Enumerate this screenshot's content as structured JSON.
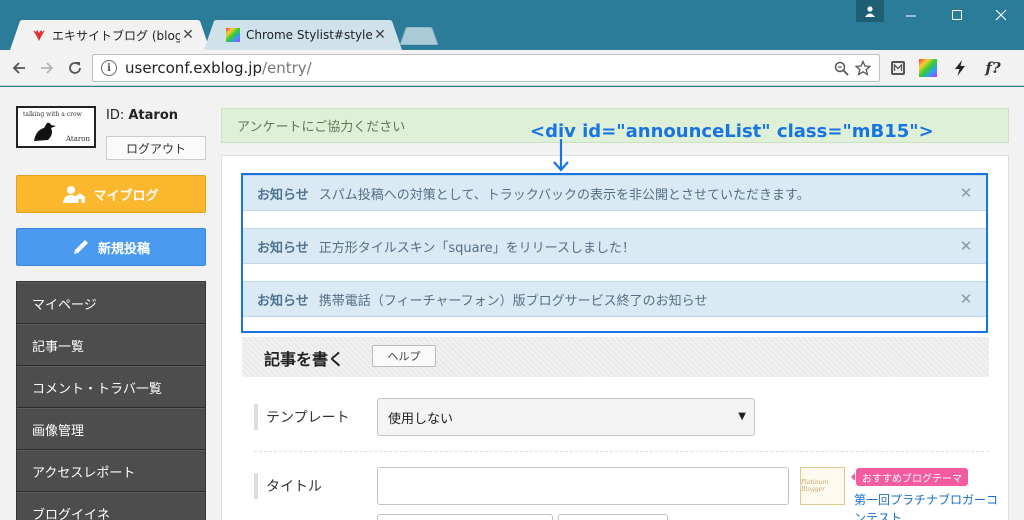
{
  "browser": {
    "tabs": [
      {
        "title": "エキサイトブログ (blog)|新規",
        "active": true
      },
      {
        "title": "Chrome Stylist#styles",
        "active": false
      }
    ],
    "url_host": "userconf.exblog.jp",
    "url_path": "/entry/",
    "ext_f_label": "f?"
  },
  "user": {
    "avatar_text_top": "talking with a crow",
    "avatar_text_bottom": "Ataron",
    "id_label": "ID:",
    "id_value": "Ataron",
    "logout_label": "ログアウト"
  },
  "actions": {
    "myblog_label": "マイブログ",
    "newpost_label": "新規投稿"
  },
  "sidenav": {
    "items": [
      "マイページ",
      "記事一覧",
      "コメント・トラバ一覧",
      "画像管理",
      "アクセスレポート",
      "ブログイイネ"
    ]
  },
  "survey_text": "アンケートにご協力ください",
  "annotation": "<div id=\"announceList\" class=\"mB15\">",
  "announcements": [
    {
      "label": "お知らせ",
      "text": "スパム投稿への対策として、トラックバックの表示を非公開とさせていただきます。"
    },
    {
      "label": "お知らせ",
      "text": "正方形タイルスキン「square」をリリースしました！"
    },
    {
      "label": "お知らせ",
      "text": "携帯電話（フィーチャーフォン）版ブログサービス終了のお知らせ"
    }
  ],
  "editor": {
    "heading": "記事を書く",
    "help_label": "ヘルプ",
    "template_label": "テンプレート",
    "template_value": "使用しない",
    "title_label": "タイトル",
    "title_value": ""
  },
  "theme": {
    "thumb_text": "Platinum Blogger",
    "badge": "おすすめブログテーマ",
    "link": "第一回プラチナブロガーコンテスト"
  },
  "colors": {
    "chrome": "#2a7c98",
    "myblog": "#fbb82e",
    "newpost": "#4a9bef",
    "annotation": "#1874e0"
  }
}
